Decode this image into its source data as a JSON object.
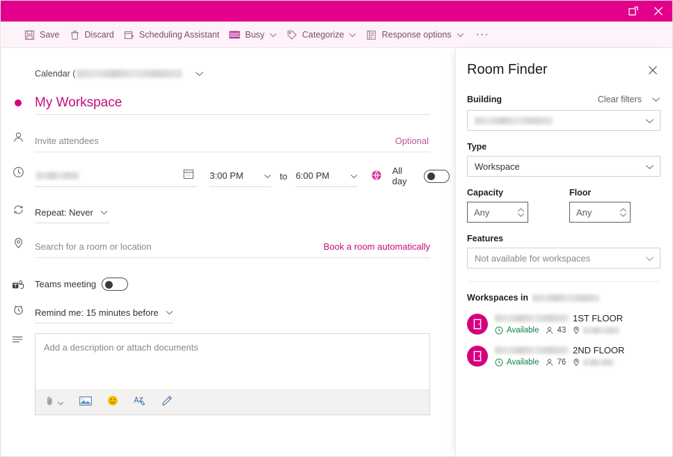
{
  "titlebar": {
    "popout_label": "Open in new window",
    "close_label": "Close",
    "background": "#e3008c"
  },
  "toolbar": {
    "save_label": "Save",
    "discard_label": "Discard",
    "scheduling_label": "Scheduling Assistant",
    "busy_label": "Busy",
    "categorize_label": "Categorize",
    "response_options_label": "Response options",
    "overflow_label": "···"
  },
  "form": {
    "calendar_label": "Calendar (",
    "calendar_value_redacted": true,
    "title_value": "My Workspace",
    "attendees_placeholder": "Invite attendees",
    "optional_label": "Optional",
    "date_value_redacted": true,
    "start_time": "3:00 PM",
    "to_label": "to",
    "end_time": "6:00 PM",
    "all_day_label": "All day",
    "all_day_on": false,
    "repeat_label": "Repeat: Never",
    "location_placeholder": "Search for a room or location",
    "book_room_label": "Book a room automatically",
    "teams_meeting_label": "Teams meeting",
    "teams_meeting_on": false,
    "remind_label": "Remind me: 15 minutes before",
    "description_placeholder": "Add a description or attach documents",
    "editor_tools": [
      {
        "name": "attach-icon",
        "label": "Attach"
      },
      {
        "name": "insert-picture-icon",
        "label": "Insert picture"
      },
      {
        "name": "emoji-icon",
        "label": "Emoji"
      },
      {
        "name": "format-text-icon",
        "label": "Format text"
      },
      {
        "name": "ink-pen-icon",
        "label": "Draw"
      }
    ]
  },
  "panel": {
    "title": "Room Finder",
    "close_label": "Close",
    "building_label": "Building",
    "clear_filters_label": "Clear filters",
    "building_value_redacted": true,
    "type_label": "Type",
    "type_value": "Workspace",
    "capacity_label": "Capacity",
    "capacity_value": "Any",
    "floor_label": "Floor",
    "floor_value": "Any",
    "features_label": "Features",
    "features_value": "Not available for workspaces",
    "workspaces_header": "Workspaces in",
    "workspaces_header_value_redacted": true,
    "workspaces": [
      {
        "name_suffix": "1ST FLOOR",
        "name_redacted": true,
        "availability": "Available",
        "capacity": "43",
        "location_redacted": true
      },
      {
        "name_suffix": "2ND FLOOR",
        "name_redacted": true,
        "availability": "Available",
        "capacity": "76",
        "location_redacted": true
      }
    ]
  },
  "colors": {
    "accent": "#d6007f",
    "accent_link": "#c30b7e",
    "toolbar_text": "#7a4c68",
    "available_green": "#0b8043"
  }
}
